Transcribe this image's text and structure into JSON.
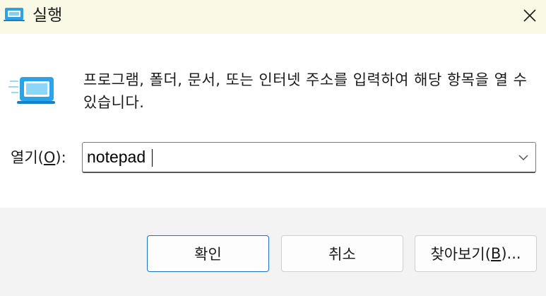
{
  "window": {
    "title": "실행",
    "close_icon": "close-icon"
  },
  "content": {
    "description": "프로그램, 폴더, 문서, 또는 인터넷 주소를 입력하여 해당 항목을 열 수 있습니다.",
    "open_label_prefix": "열기(",
    "open_label_mnemonic": "O",
    "open_label_suffix": "):",
    "open_value": "notepad"
  },
  "buttons": {
    "ok": "확인",
    "cancel": "취소",
    "browse_prefix": "찾아보기(",
    "browse_mnemonic": "B",
    "browse_suffix": ")..."
  },
  "colors": {
    "titlebar": "#f9f9e5",
    "footer": "#f3f3f3",
    "accent": "#1f6fc5",
    "icon_blue": "#2aa3e8"
  }
}
